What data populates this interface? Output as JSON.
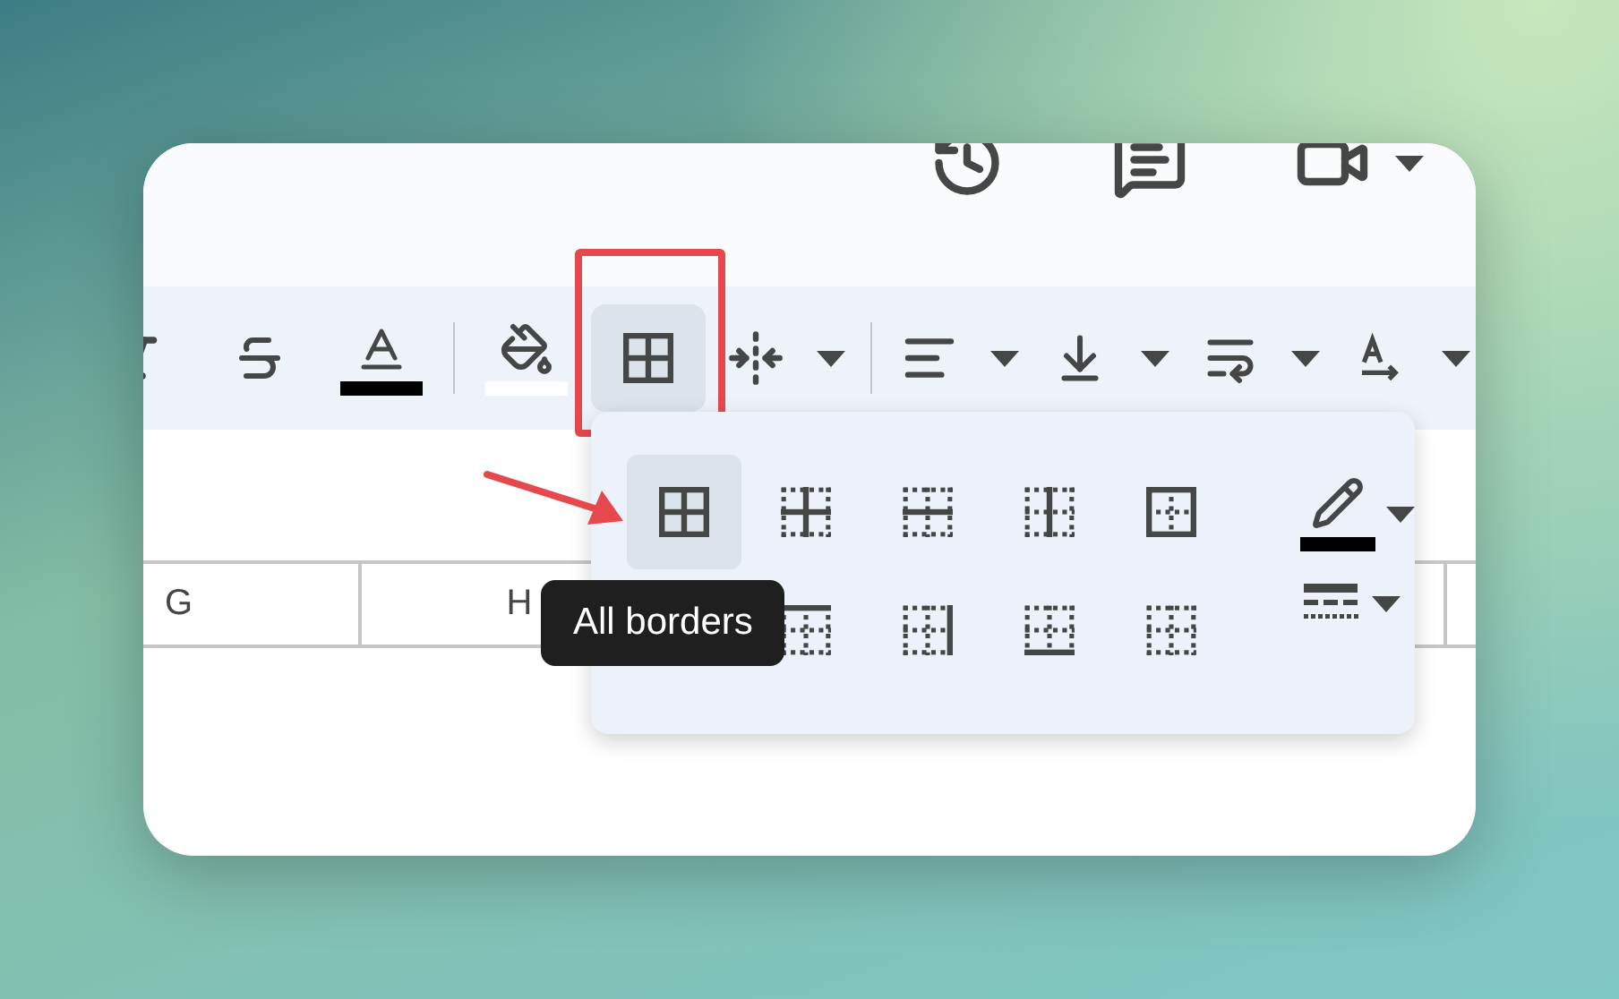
{
  "top_actions": [
    {
      "kind": "history"
    },
    {
      "kind": "comments"
    },
    {
      "kind": "meet",
      "has_menu": true
    }
  ],
  "toolbar": [
    {
      "kind": "italic",
      "selected": false,
      "has_menu": false
    },
    {
      "kind": "strikethrough",
      "selected": false,
      "has_menu": false
    },
    {
      "kind": "text_color",
      "selected": false,
      "has_menu": false,
      "color": "#000000"
    },
    {
      "kind": "separator"
    },
    {
      "kind": "fill_color",
      "selected": false,
      "has_menu": false,
      "color": "#ffffff"
    },
    {
      "kind": "borders",
      "selected": true,
      "has_menu": false
    },
    {
      "kind": "merge",
      "selected": false,
      "has_menu": true
    },
    {
      "kind": "separator"
    },
    {
      "kind": "align",
      "selected": false,
      "has_menu": true
    },
    {
      "kind": "valign",
      "selected": false,
      "has_menu": true
    },
    {
      "kind": "wrap",
      "selected": false,
      "has_menu": true
    },
    {
      "kind": "rotate",
      "selected": false,
      "has_menu": true
    }
  ],
  "column_headers": [
    {
      "label": "G"
    },
    {
      "label": "H"
    }
  ],
  "border_menu": {
    "row_1": [
      {
        "kind": "all",
        "selected": true
      },
      {
        "kind": "inner",
        "selected": false
      },
      {
        "kind": "horizontal",
        "selected": false
      },
      {
        "kind": "vertical",
        "selected": false
      },
      {
        "kind": "outer",
        "selected": false
      }
    ],
    "row_2": [
      {
        "kind": "top",
        "selected": false
      },
      {
        "kind": "right",
        "selected": false
      },
      {
        "kind": "bottom",
        "selected": false
      },
      {
        "kind": "clear",
        "selected": false
      }
    ],
    "pen": {
      "color": "#000000"
    }
  },
  "tooltip": {
    "text": "All borders"
  }
}
